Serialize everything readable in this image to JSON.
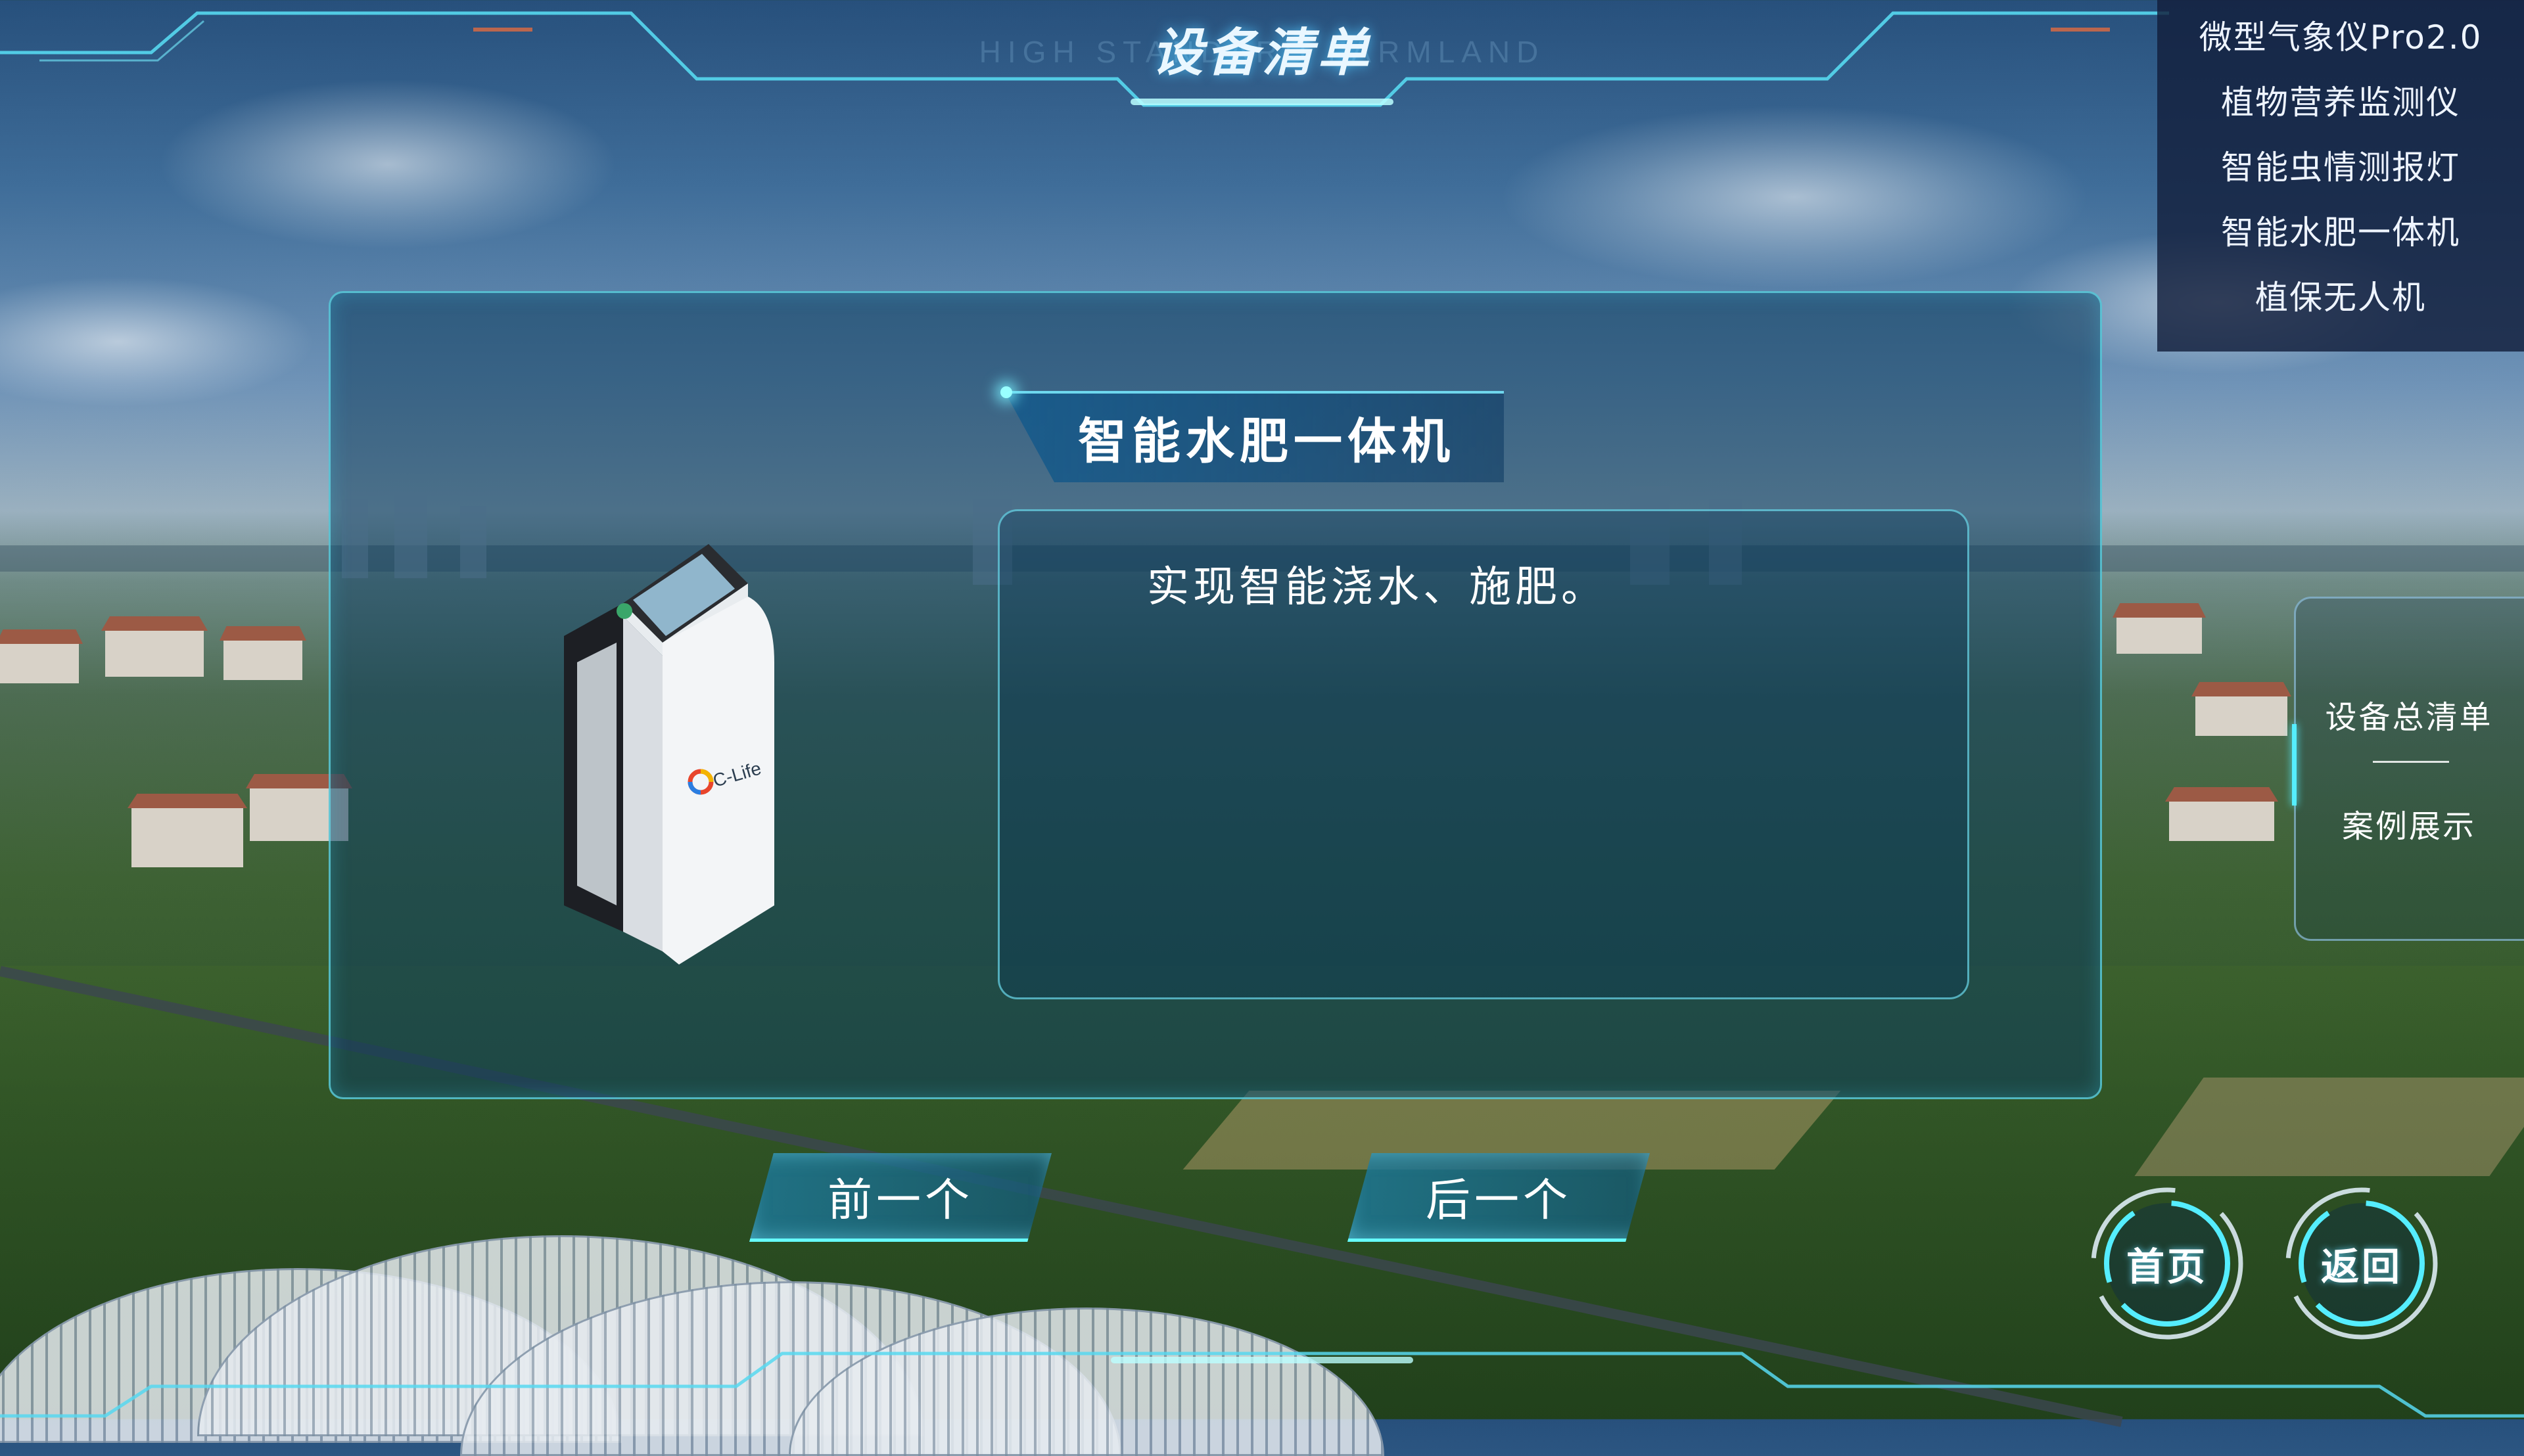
{
  "header": {
    "title": "设备清单",
    "subtitle": "HIGH STANDARD FARMLAND"
  },
  "product": {
    "name": "智能水肥一体机",
    "description": "实现智能浇水、施肥。",
    "brand": "C-Life"
  },
  "navigation": {
    "prev_label": "前一个",
    "next_label": "后一个"
  },
  "device_list": {
    "items": [
      {
        "label": "微型气象仪Pro2.0"
      },
      {
        "label": "植物营养监测仪"
      },
      {
        "label": "智能虫情测报灯"
      },
      {
        "label": "智能水肥一体机"
      },
      {
        "label": "植保无人机"
      }
    ]
  },
  "side_menu": {
    "items": [
      {
        "label": "设备总清单"
      },
      {
        "label": "案例展示"
      }
    ]
  },
  "buttons": {
    "home_label": "首页",
    "back_label": "返回"
  },
  "colors": {
    "accent": "#55eeff",
    "panel_border": "#64dceb"
  }
}
